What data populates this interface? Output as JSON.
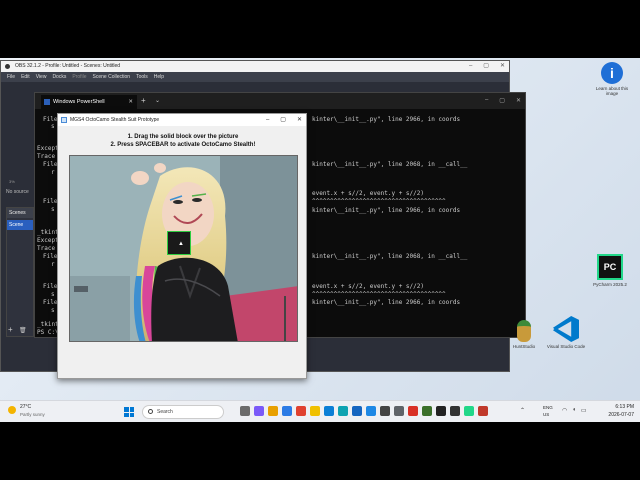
{
  "obs": {
    "title": "OBS 32.1.2 - Profile: Untitled - Scenes: Untitled",
    "menu": [
      "File",
      "Edit",
      "View",
      "Docks",
      "Profile",
      "Scene Collection",
      "Tools",
      "Help"
    ],
    "zoom": "3%",
    "no_source": "No source",
    "scenes_header": "Scenes",
    "scene_item": "Scene"
  },
  "powershell": {
    "tab_title": "Windows PowerShell",
    "lines_right": [
      "kinter\\__init__.py\", line 2966, in coords",
      "kinter\\__init__.py\", line 2068, in __call__",
      "event.x + s//2, event.y + s//2)",
      "^^^^^^^^^^^^^^^^^^^^^^^^^^^^^^^^^^^^^",
      "kinter\\__init__.py\", line 2966, in coords",
      "kinter\\__init__.py\", line 2068, in __call__",
      "event.x + s//2, event.y + s//2)",
      "^^^^^^^^^^^^^^^^^^^^^^^^^^^^^^^^^^^^^",
      "kinter\\__init__.py\", line 2966, in coords"
    ],
    "lines_left": [
      "File",
      "s",
      "Except",
      "Trace",
      "File",
      "r",
      "File",
      "s",
      "_tkint",
      "Except",
      "Trace",
      "File",
      "r",
      "File",
      "s",
      "File",
      "s",
      "_tkint",
      "PS C:\\"
    ]
  },
  "octocamo": {
    "title": "MGS4 OctoCamo Stealth Suit Prototype",
    "instruction_1": "1. Drag the solid block over the picture",
    "instruction_2": "2. Press SPACEBAR to activate OctoCamo Stealth!"
  },
  "desktop_icons": {
    "learn_label": "Learn about this image",
    "pycharm_label": "PyCharm 2025.2",
    "vscode_label": "Visual Studio Code",
    "pineapple_label": "HuntStudio"
  },
  "taskbar": {
    "temperature": "27°C",
    "condition": "Partly sunny",
    "search_placeholder": "Search",
    "lang_1": "ENG",
    "lang_2": "US",
    "time": "6:13 PM",
    "date": "2026-07-07"
  },
  "colors": {
    "accent": "#0078d4",
    "green_block": "#1a1a1a",
    "green_border": "#2ecc40"
  }
}
